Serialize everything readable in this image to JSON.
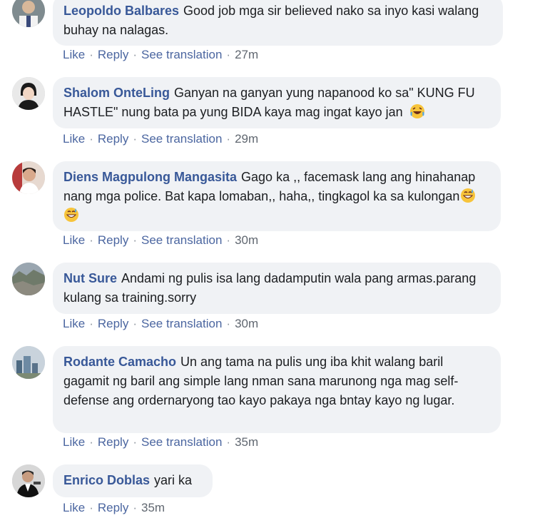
{
  "comments": [
    {
      "author": "Leopoldo Balbares",
      "text": "Good job mga sir believed nako sa inyo kasi walang buhay na nalagas.",
      "like": "Like",
      "reply": "Reply",
      "translate": "See translation",
      "time": "27m"
    },
    {
      "author": "Shalom OnteLing",
      "text": "Ganyan na ganyan yung napanood ko sa\" KUNG FU HASTLE\" nung bata pa yung BIDA kaya mag ingat kayo jan",
      "like": "Like",
      "reply": "Reply",
      "translate": "See translation",
      "time": "29m"
    },
    {
      "author": "Diens Magpulong Mangasita",
      "text": "Gago ka ,, facemask lang ang hinahanap nang mga police. Bat kapa lomaban,, haha,, tingkagol ka sa kulongan",
      "like": "Like",
      "reply": "Reply",
      "translate": "See translation",
      "time": "30m"
    },
    {
      "author": "Nut Sure",
      "text": "Andami ng pulis isa lang dadamputin wala pang armas.parang kulang sa training.sorry",
      "like": "Like",
      "reply": "Reply",
      "translate": "See translation",
      "time": "30m"
    },
    {
      "author": "Rodante Camacho",
      "text": "Un ang tama na pulis ung iba khit walang baril gagamit ng baril ang simple lang nman sana marunong nga mag self-defense ang ordernaryong tao kayo pakaya nga bntay kayo ng lugar.",
      "like": "Like",
      "reply": "Reply",
      "translate": "See translation",
      "time": "35m"
    },
    {
      "author": "Enrico Doblas",
      "text": "yari ka",
      "like": "Like",
      "reply": "Reply",
      "time": "35m"
    }
  ]
}
